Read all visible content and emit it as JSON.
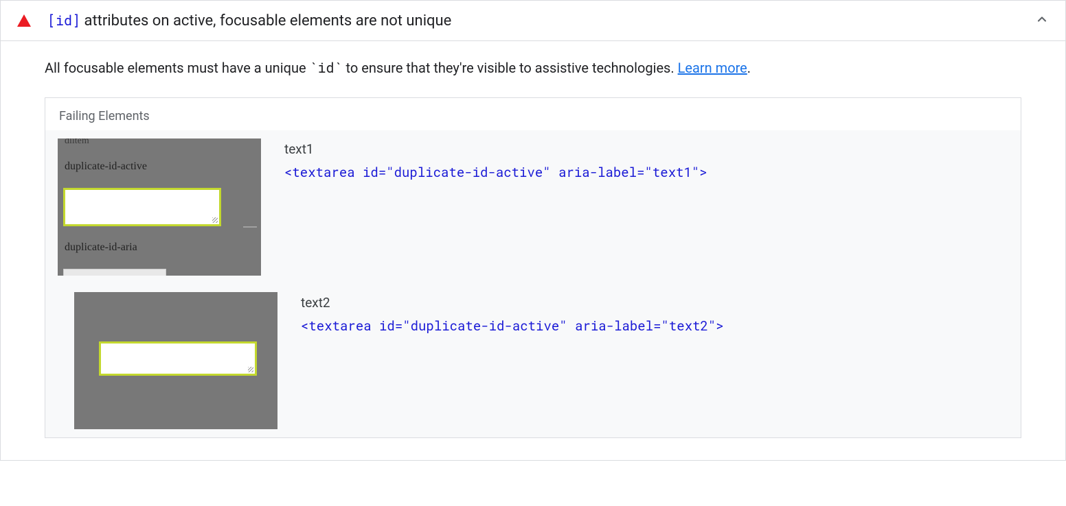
{
  "audit": {
    "header_code": "[id]",
    "header_text": " attributes on active, focusable elements are not unique",
    "description_pre": "All focusable elements must have a unique ",
    "description_code": "`id`",
    "description_post": " to ensure that they're visible to assistive technologies. ",
    "learn_more": "Learn more",
    "period": "."
  },
  "panel": {
    "title": "Failing Elements"
  },
  "thumb1": {
    "cut_text": "dlitem",
    "label1": "duplicate-id-active",
    "label2": "duplicate-id-aria"
  },
  "items": [
    {
      "label": "text1",
      "code": "<textarea id=\"duplicate-id-active\" aria-label=\"text1\">"
    },
    {
      "label": "text2",
      "code": "<textarea id=\"duplicate-id-active\" aria-label=\"text2\">"
    }
  ]
}
